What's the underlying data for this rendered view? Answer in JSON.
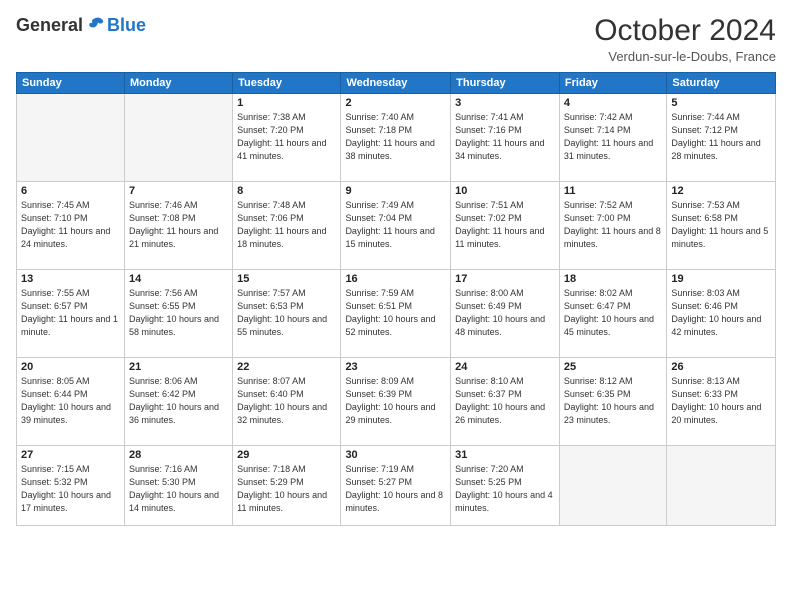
{
  "logo": {
    "general": "General",
    "blue": "Blue"
  },
  "header": {
    "title": "October 2024",
    "location": "Verdun-sur-le-Doubs, France"
  },
  "weekdays": [
    "Sunday",
    "Monday",
    "Tuesday",
    "Wednesday",
    "Thursday",
    "Friday",
    "Saturday"
  ],
  "weeks": [
    [
      {
        "day": "",
        "info": ""
      },
      {
        "day": "",
        "info": ""
      },
      {
        "day": "1",
        "info": "Sunrise: 7:38 AM\nSunset: 7:20 PM\nDaylight: 11 hours and 41 minutes."
      },
      {
        "day": "2",
        "info": "Sunrise: 7:40 AM\nSunset: 7:18 PM\nDaylight: 11 hours and 38 minutes."
      },
      {
        "day": "3",
        "info": "Sunrise: 7:41 AM\nSunset: 7:16 PM\nDaylight: 11 hours and 34 minutes."
      },
      {
        "day": "4",
        "info": "Sunrise: 7:42 AM\nSunset: 7:14 PM\nDaylight: 11 hours and 31 minutes."
      },
      {
        "day": "5",
        "info": "Sunrise: 7:44 AM\nSunset: 7:12 PM\nDaylight: 11 hours and 28 minutes."
      }
    ],
    [
      {
        "day": "6",
        "info": "Sunrise: 7:45 AM\nSunset: 7:10 PM\nDaylight: 11 hours and 24 minutes."
      },
      {
        "day": "7",
        "info": "Sunrise: 7:46 AM\nSunset: 7:08 PM\nDaylight: 11 hours and 21 minutes."
      },
      {
        "day": "8",
        "info": "Sunrise: 7:48 AM\nSunset: 7:06 PM\nDaylight: 11 hours and 18 minutes."
      },
      {
        "day": "9",
        "info": "Sunrise: 7:49 AM\nSunset: 7:04 PM\nDaylight: 11 hours and 15 minutes."
      },
      {
        "day": "10",
        "info": "Sunrise: 7:51 AM\nSunset: 7:02 PM\nDaylight: 11 hours and 11 minutes."
      },
      {
        "day": "11",
        "info": "Sunrise: 7:52 AM\nSunset: 7:00 PM\nDaylight: 11 hours and 8 minutes."
      },
      {
        "day": "12",
        "info": "Sunrise: 7:53 AM\nSunset: 6:58 PM\nDaylight: 11 hours and 5 minutes."
      }
    ],
    [
      {
        "day": "13",
        "info": "Sunrise: 7:55 AM\nSunset: 6:57 PM\nDaylight: 11 hours and 1 minute."
      },
      {
        "day": "14",
        "info": "Sunrise: 7:56 AM\nSunset: 6:55 PM\nDaylight: 10 hours and 58 minutes."
      },
      {
        "day": "15",
        "info": "Sunrise: 7:57 AM\nSunset: 6:53 PM\nDaylight: 10 hours and 55 minutes."
      },
      {
        "day": "16",
        "info": "Sunrise: 7:59 AM\nSunset: 6:51 PM\nDaylight: 10 hours and 52 minutes."
      },
      {
        "day": "17",
        "info": "Sunrise: 8:00 AM\nSunset: 6:49 PM\nDaylight: 10 hours and 48 minutes."
      },
      {
        "day": "18",
        "info": "Sunrise: 8:02 AM\nSunset: 6:47 PM\nDaylight: 10 hours and 45 minutes."
      },
      {
        "day": "19",
        "info": "Sunrise: 8:03 AM\nSunset: 6:46 PM\nDaylight: 10 hours and 42 minutes."
      }
    ],
    [
      {
        "day": "20",
        "info": "Sunrise: 8:05 AM\nSunset: 6:44 PM\nDaylight: 10 hours and 39 minutes."
      },
      {
        "day": "21",
        "info": "Sunrise: 8:06 AM\nSunset: 6:42 PM\nDaylight: 10 hours and 36 minutes."
      },
      {
        "day": "22",
        "info": "Sunrise: 8:07 AM\nSunset: 6:40 PM\nDaylight: 10 hours and 32 minutes."
      },
      {
        "day": "23",
        "info": "Sunrise: 8:09 AM\nSunset: 6:39 PM\nDaylight: 10 hours and 29 minutes."
      },
      {
        "day": "24",
        "info": "Sunrise: 8:10 AM\nSunset: 6:37 PM\nDaylight: 10 hours and 26 minutes."
      },
      {
        "day": "25",
        "info": "Sunrise: 8:12 AM\nSunset: 6:35 PM\nDaylight: 10 hours and 23 minutes."
      },
      {
        "day": "26",
        "info": "Sunrise: 8:13 AM\nSunset: 6:33 PM\nDaylight: 10 hours and 20 minutes."
      }
    ],
    [
      {
        "day": "27",
        "info": "Sunrise: 7:15 AM\nSunset: 5:32 PM\nDaylight: 10 hours and 17 minutes."
      },
      {
        "day": "28",
        "info": "Sunrise: 7:16 AM\nSunset: 5:30 PM\nDaylight: 10 hours and 14 minutes."
      },
      {
        "day": "29",
        "info": "Sunrise: 7:18 AM\nSunset: 5:29 PM\nDaylight: 10 hours and 11 minutes."
      },
      {
        "day": "30",
        "info": "Sunrise: 7:19 AM\nSunset: 5:27 PM\nDaylight: 10 hours and 8 minutes."
      },
      {
        "day": "31",
        "info": "Sunrise: 7:20 AM\nSunset: 5:25 PM\nDaylight: 10 hours and 4 minutes."
      },
      {
        "day": "",
        "info": ""
      },
      {
        "day": "",
        "info": ""
      }
    ]
  ]
}
